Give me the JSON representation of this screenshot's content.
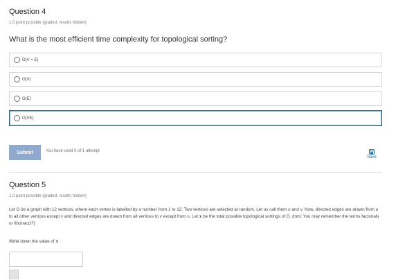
{
  "question4": {
    "title": "Question 4",
    "meta": "1.0 point possible (graded, results hidden)",
    "prompt": "What is the most efficient time complexity for topological sorting?",
    "options": [
      {
        "label": "O(V + E)",
        "selected": false
      },
      {
        "label": "O(V)",
        "selected": false
      },
      {
        "label": "O(E)",
        "selected": false
      },
      {
        "label": "O(VE)",
        "selected": true
      }
    ],
    "submit_label": "Submit",
    "attempts_text": "You have used 0 of 1 attempt",
    "save_label": "Save",
    "save_icon": "save-icon"
  },
  "question5": {
    "title": "Question 5",
    "meta": "1.0 point possible (graded, results hidden)",
    "body_part1": "Let G be a graph with 12 vertices, where each vertex is labelled by a number from 1 to 12. Two vertices are selected at random. Let us call them u and v. Now, directed edges are drawn from u to all other vertices except v and directed edges are drawn from all vertices to v except from u. Let ",
    "body_var": "x",
    "body_part2": " be the total possible topological sortings of G. (hint: You may remember the terms factorials or fibonacci?)",
    "write_label_prefix": "Write down the value of ",
    "write_label_var": "x",
    "answer_value": "",
    "answer_placeholder": ""
  },
  "colors": {
    "selected_border": "#126f9a",
    "submit_bg": "#8fa9cf",
    "save_blue": "#126f9a"
  }
}
